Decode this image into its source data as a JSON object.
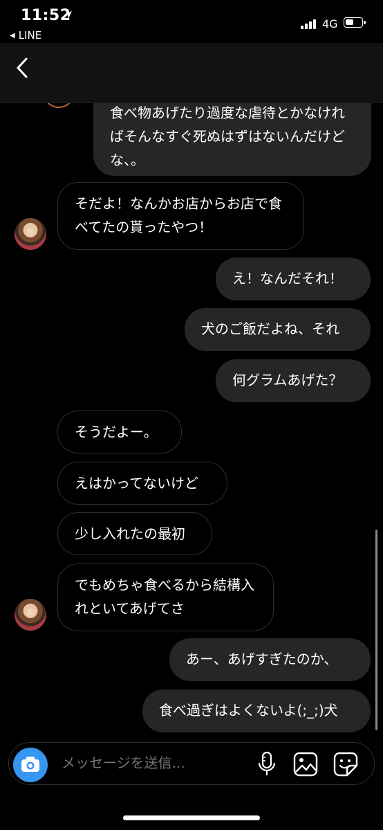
{
  "status_bar": {
    "time": "11:52",
    "back_app": "LINE",
    "network": "4G"
  },
  "messages": [
    {
      "from": "me",
      "text": "食べ物あげたり過度な虐待とかなければそんなすぐ死ぬはずはないんだけどな、。"
    },
    {
      "from": "them",
      "text": "そだよ！なんかお店からお店で食べてたの貰ったやつ！"
    },
    {
      "from": "me",
      "text": "え！なんだそれ！"
    },
    {
      "from": "me",
      "text": "犬のご飯だよね、それ"
    },
    {
      "from": "me",
      "text": "何グラムあげた？"
    },
    {
      "from": "them",
      "text": "そうだよー。"
    },
    {
      "from": "them",
      "text": "えはかってないけど"
    },
    {
      "from": "them",
      "text": "少し入れたの最初"
    },
    {
      "from": "them",
      "text": "でもめちゃ食べるから結構入れといてあげてさ"
    },
    {
      "from": "me",
      "text": "あー、あげすぎたのか、"
    },
    {
      "from": "me",
      "text": "食べ過ぎはよくないよ(;_;)犬"
    }
  ],
  "composer": {
    "placeholder": "メッセージを送信..."
  },
  "colors": {
    "accent": "#3797f0",
    "my_bubble": "#262626",
    "background": "#000000"
  }
}
